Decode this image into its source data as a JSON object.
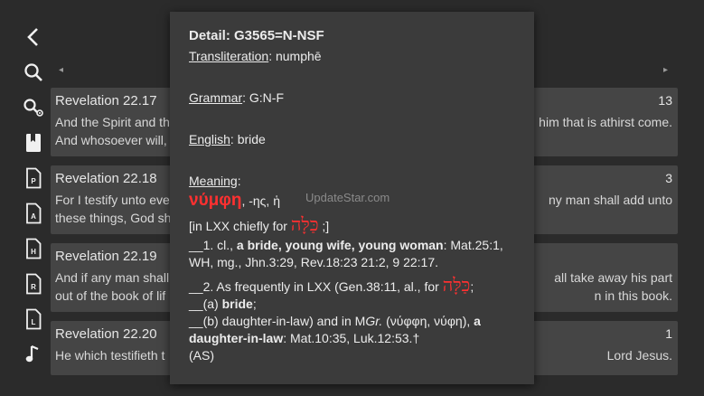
{
  "nav": {
    "prev_arrow": "◂",
    "next_arrow": "▸"
  },
  "sidebar": {
    "icons": [
      "back-icon",
      "search-icon",
      "search-settings-icon",
      "bookmark-icon",
      "p-document-icon",
      "a-document-icon",
      "h-document-icon",
      "r-document-icon",
      "l-document-icon",
      "music-note-icon"
    ],
    "letters": {
      "p": "P",
      "a": "A",
      "h": "H",
      "r": "R",
      "l": "L"
    }
  },
  "verses": [
    {
      "ref": "Revelation 22.17",
      "count": "13",
      "left_line1": "And the Spirit and th",
      "left_line2": "And whosoever will,",
      "right_line1": "him that is athirst come.",
      "right_line2": ""
    },
    {
      "ref": "Revelation 22.18",
      "count": "3",
      "left_line1": "For I testify unto eve",
      "left_line2": "these things, God sh",
      "right_line1": "ny man shall add unto",
      "right_line2": ""
    },
    {
      "ref": "Revelation 22.19",
      "count": "",
      "left_line1": "And if any man shall",
      "left_line2": "out of the book of lif",
      "right_line1": "all take away his part",
      "right_line2": "n in this book."
    },
    {
      "ref": "Revelation 22.20",
      "count": "1",
      "left_line1": "He which testifieth t",
      "left_line2": "",
      "right_line1": "Lord Jesus.",
      "right_line2": ""
    }
  ],
  "popup": {
    "title": "Detail: G3565=N-NSF",
    "translit_label": "Transliteration",
    "translit_value": ": numphē",
    "grammar_label": "Grammar",
    "grammar_value": ": G:N-F",
    "english_label": "English",
    "english_value": ": bride",
    "meaning_label": "Meaning",
    "meaning_colon": ":",
    "greek_word": "νύμφη",
    "greek_suffix": ", -ης, ἡ",
    "lxx_prefix": "[in LXX chiefly for ",
    "lxx_hebrew": "כַּלָּה",
    "lxx_suffix": " ;]",
    "def1_prefix": "__1. cl., ",
    "def1_bold": "a bride, young wife, young woman",
    "def1_refs": ": Mat.25:1, WH, mg., Jhn.3:29, Rev.18:23 21:2, 9 22:17.",
    "def2_prefix": "__2. As frequently in LXX (Gen.38:11, al., for ",
    "def2_hebrew": "כַּלָּה",
    "def2_suffix": ";",
    "def2a_prefix": "__(a) ",
    "def2a_bold": "bride",
    "def2a_suffix": ";",
    "def2b_prefix": "__(b) daughter-in-law) and in M",
    "def2b_italic": "Gr.",
    "def2b_mid": " (νύφφη, νύφη), ",
    "def2b_bold": "a daughter-in-law",
    "def2b_refs": ": Mat.10:35, Luk.12:53.†",
    "source": "(AS)"
  },
  "watermark": "UpdateStar.com"
}
